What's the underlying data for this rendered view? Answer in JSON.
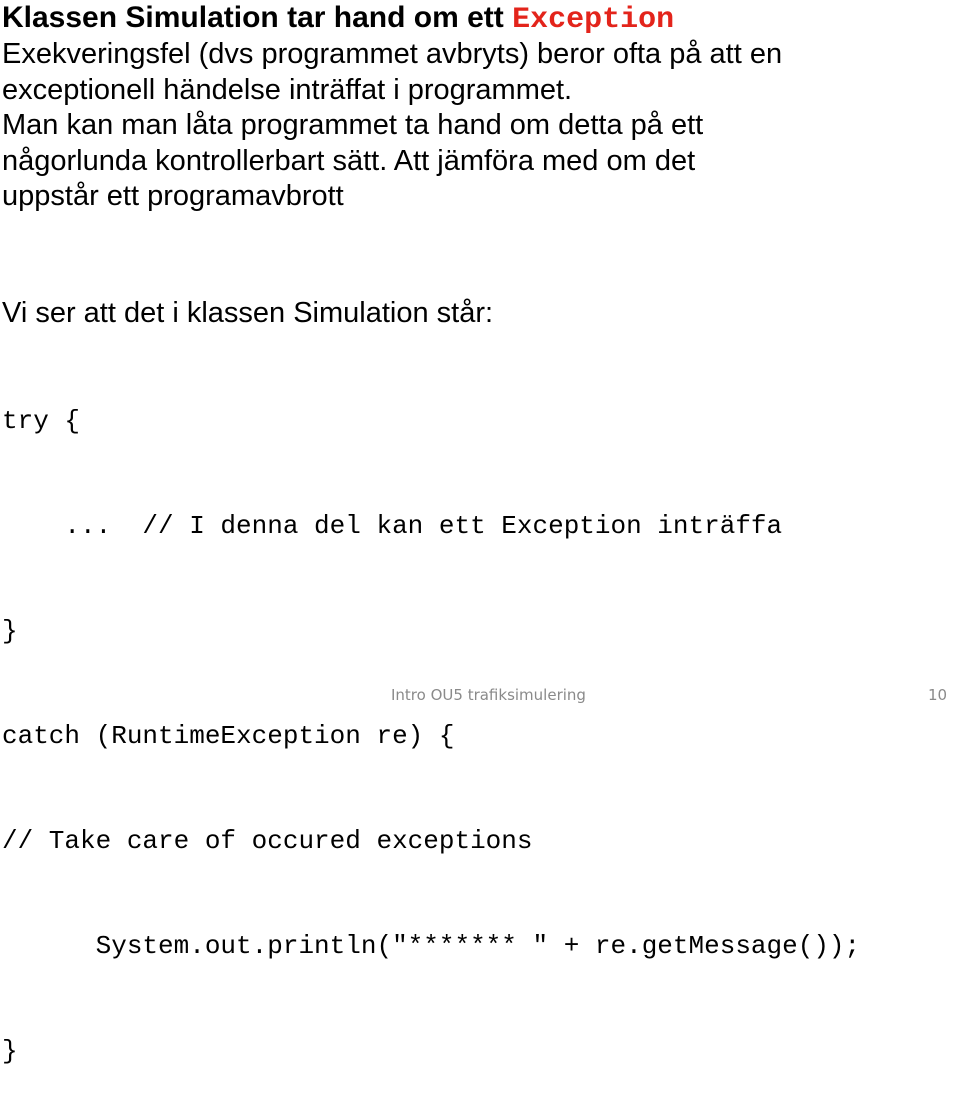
{
  "slide": {
    "title": {
      "text": "Klassen Simulation tar hand om ett ",
      "keyword": "Exception",
      "keyword_color": "#e3241b"
    },
    "paragraph1": [
      "Exekveringsfel (dvs programmet avbryts) beror ofta på att en",
      "exceptionell händelse inträffat i programmet.",
      "Man kan man låta programmet ta hand om detta på ett",
      "någorlunda kontrollerbart  sätt.  Att jämföra med om det",
      "uppstår ett programavbrott"
    ],
    "paragraph2": "Vi ser att det i klassen Simulation står:",
    "code_lines": [
      "try {",
      "    ...  // I denna del kan ett Exception inträffa",
      "}",
      "catch (RuntimeException re) {",
      "// Take care of occured exceptions",
      "      System.out.println(\"******* \" + re.getMessage());",
      "}"
    ],
    "footer": {
      "title": "Intro OU5 trafiksimulering",
      "page_number": "10"
    }
  }
}
